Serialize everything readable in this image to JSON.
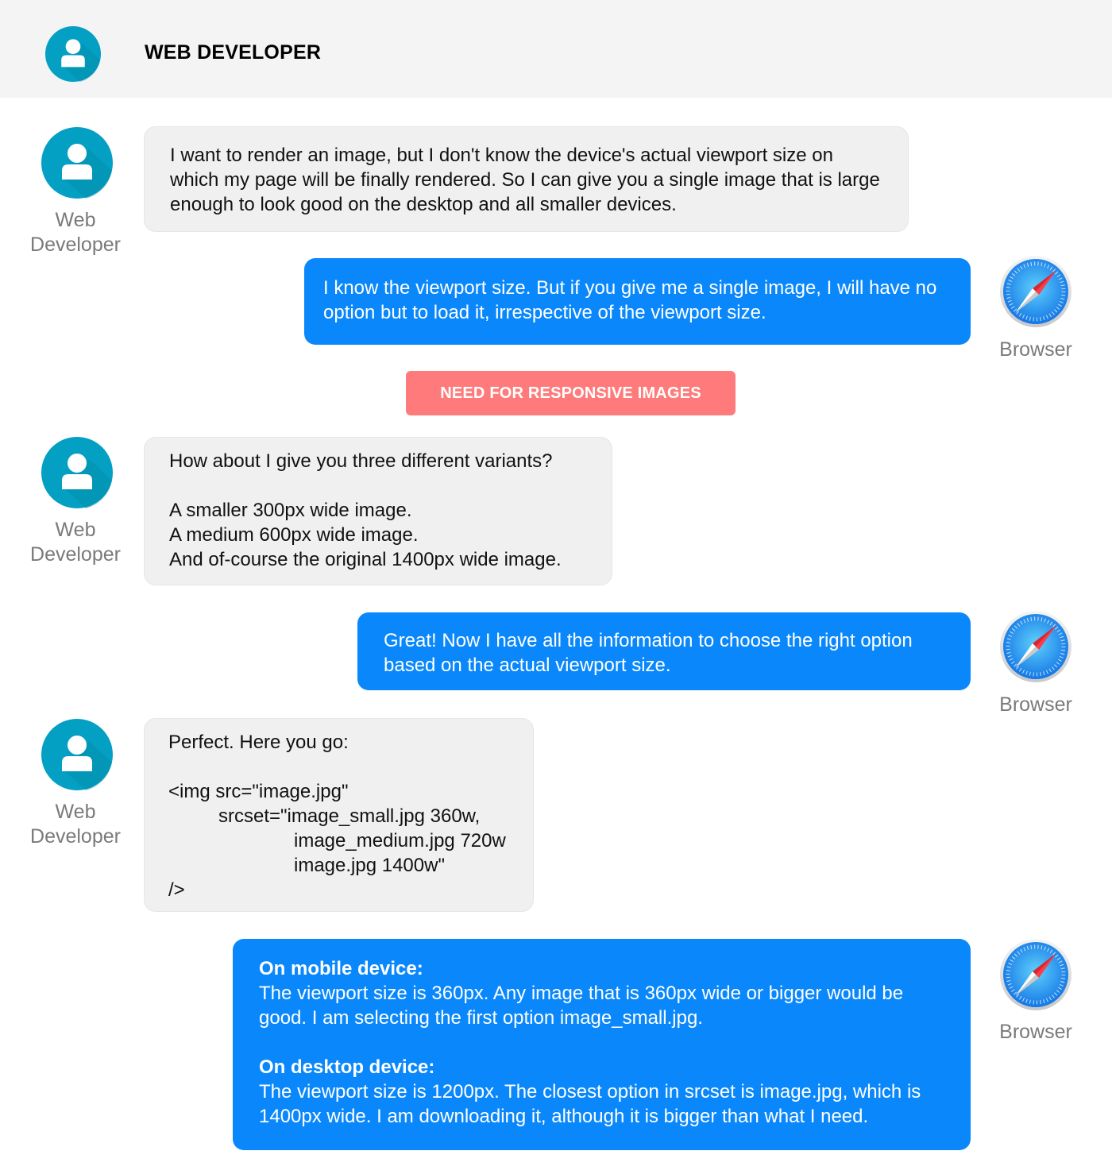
{
  "header": {
    "title": "WEB DEVELOPER",
    "avatar_icon": "user-avatar-icon"
  },
  "colors": {
    "developer_avatar": "#03a0c4",
    "developer_bubble": "#f0f0f0",
    "browser_bubble": "#0a88fb",
    "banner": "#ff7b7b",
    "header_bg": "#f4f4f4",
    "label_gray": "#7a7a7a"
  },
  "actors": {
    "developer": {
      "label_line1": "Web",
      "label_line2": "Developer",
      "icon": "user-avatar-icon"
    },
    "browser": {
      "label": "Browser",
      "icon": "safari-compass-icon"
    }
  },
  "banner": {
    "text": "NEED FOR RESPONSIVE IMAGES"
  },
  "messages": [
    {
      "from": "developer",
      "text": "I want to render an image, but I don't know the device's actual viewport size on which my page will be finally rendered. So I can give you a single image that is large enough to look good on the desktop and all smaller devices."
    },
    {
      "from": "browser",
      "text": "I know the viewport size. But if you give me a single image, I will have no option but to load it, irrespective of the viewport size."
    },
    {
      "from": "developer",
      "lines": [
        "How about I give you three different variants?",
        "",
        "A smaller 300px wide image.",
        "A medium 600px wide image.",
        "And of-course the original 1400px wide image."
      ]
    },
    {
      "from": "browser",
      "text": "Great! Now I have all the information to choose the right option based on the actual viewport size."
    },
    {
      "from": "developer",
      "lines": [
        "Perfect. Here you go:",
        "",
        "<img src=\"image.jpg\"",
        "srcset=\"image_small.jpg 360w,",
        "image_medium.jpg 720w",
        "image.jpg 1400w\"",
        "/>"
      ]
    },
    {
      "from": "browser",
      "mobile_heading": "On mobile device:",
      "mobile_text": "The viewport size is 360px. Any image that is 360px wide or bigger would be good. I am selecting the first option image_small.jpg.",
      "desktop_heading": "On desktop device:",
      "desktop_text": "The viewport size is 1200px. The closest option in srcset is image.jpg, which is 1400px wide. I am downloading it, although it is bigger than what I need."
    }
  ]
}
